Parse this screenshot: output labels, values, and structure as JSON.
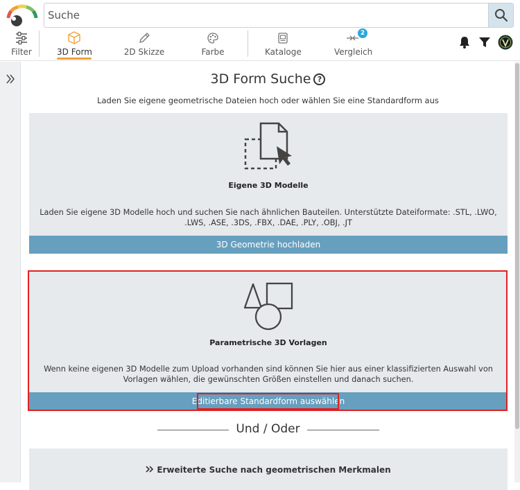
{
  "search": {
    "placeholder": "Suche"
  },
  "nav": {
    "tabs": [
      {
        "label": "Filter",
        "icon": "sliders-icon"
      },
      {
        "label": "3D Form",
        "icon": "cube-icon",
        "active": true
      },
      {
        "label": "2D Skizze",
        "icon": "pencil-icon"
      },
      {
        "label": "Farbe",
        "icon": "palette-icon"
      },
      {
        "label": "Kataloge",
        "icon": "catalog-icon"
      },
      {
        "label": "Vergleich",
        "icon": "compare-icon",
        "badge": "2"
      }
    ],
    "accent_color": "#f0a13a",
    "badge_color": "#2aa7dc"
  },
  "header_icons": [
    "bell-icon",
    "filter-icon",
    "user-avatar"
  ],
  "main": {
    "title": "3D Form Suche",
    "subtitle": "Laden Sie eigene geometrische Dateien hoch oder wählen Sie eine Standardform aus",
    "card_upload": {
      "title": "Eigene 3D Modelle",
      "description": "Laden Sie eigene 3D Modelle hoch und suchen Sie nach ähnlichen Bauteilen. Unterstützte Dateiformate: .STL, .LWO, .LWS, .ASE, .3DS, .FBX, .DAE, .PLY, .OBJ, .JT",
      "button": "3D Geometrie hochladen"
    },
    "card_templates": {
      "title": "Parametrische 3D Vorlagen",
      "description": "Wenn keine eigenen 3D Modelle zum Upload vorhanden sind können Sie hier aus einer klassifizierten Auswahl von Vorlagen wählen, die gewünschten Größen einstellen und danach suchen.",
      "button": "Editierbare Standardform auswählen"
    },
    "divider_text": "Und / Oder",
    "advanced_search": "Erweiterte Suche nach geometrischen Merkmalen",
    "button_color": "#679fbf",
    "highlight_color": "#e02020"
  }
}
